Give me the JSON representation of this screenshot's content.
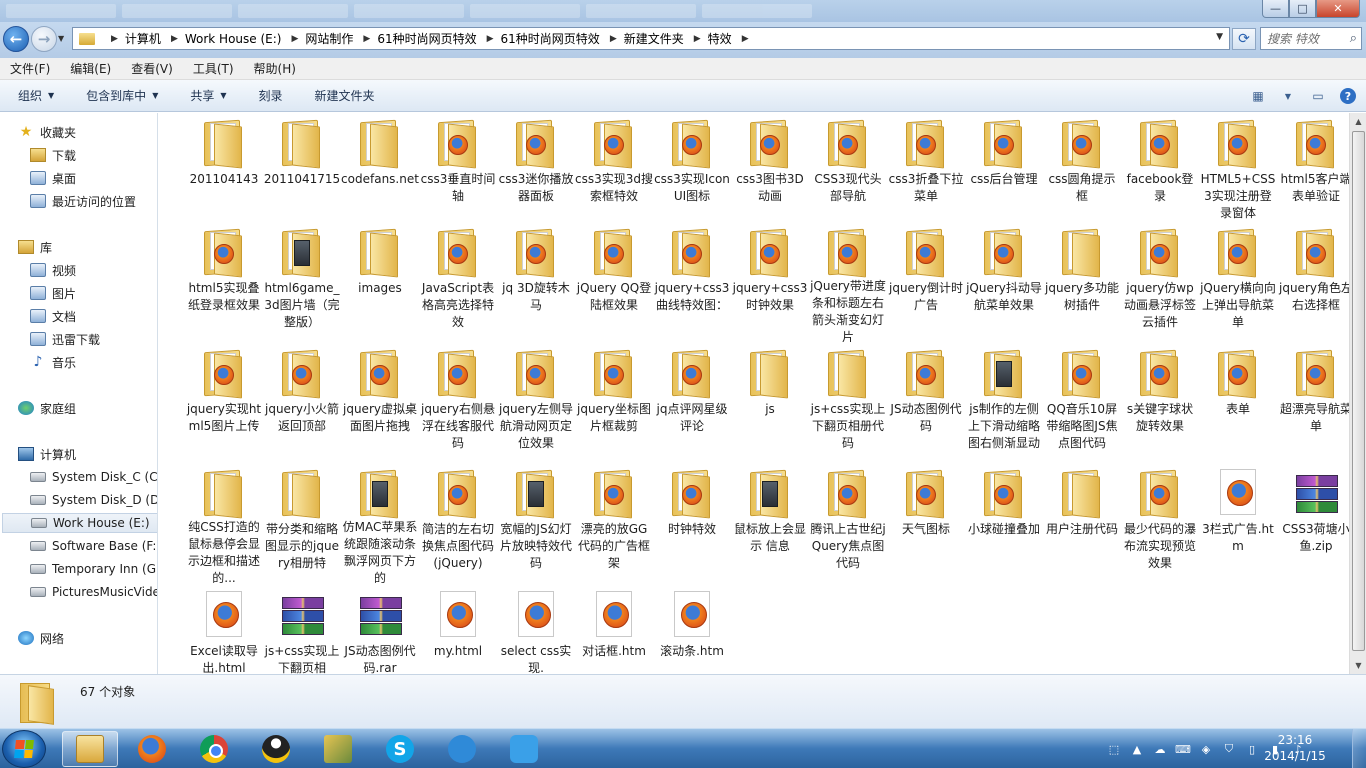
{
  "window": {
    "buttons": {
      "minimize": "—",
      "maximize": "□",
      "close": "✕"
    }
  },
  "address_bar": {
    "crumbs": [
      "计算机",
      "Work House (E:)",
      "网站制作",
      "61种时尚网页特效",
      "61种时尚网页特效",
      "新建文件夹",
      "特效"
    ],
    "search_placeholder": "搜索 特效"
  },
  "menu": [
    "文件(F)",
    "编辑(E)",
    "查看(V)",
    "工具(T)",
    "帮助(H)"
  ],
  "toolbar": {
    "organize": "组织",
    "include_in_library": "包含到库中",
    "share": "共享",
    "burn": "刻录",
    "new_folder": "新建文件夹"
  },
  "nav": {
    "favorites": "收藏夹",
    "downloads": "下载",
    "desktop": "桌面",
    "recent": "最近访问的位置",
    "libraries": "库",
    "videos": "视频",
    "pictures": "图片",
    "documents": "文档",
    "xunlei": "迅雷下载",
    "music": "音乐",
    "homegroup": "家庭组",
    "computer": "计算机",
    "drive_c": "System Disk_C  (C:",
    "drive_d": "System Disk_D (D:)",
    "drive_e": "Work House (E:)",
    "drive_f": "Software Base (F:)",
    "drive_g": "Temporary Inn (G:",
    "drive_h": "PicturesMusicVide",
    "network": "网络"
  },
  "items": [
    {
      "name": "201104143",
      "kind": "folder"
    },
    {
      "name": "2011041715",
      "kind": "folder"
    },
    {
      "name": "codefans.net",
      "kind": "folder"
    },
    {
      "name": "css3垂直时间轴",
      "kind": "folder-ff"
    },
    {
      "name": "css3迷你播放器面板",
      "kind": "folder-ff"
    },
    {
      "name": "css3实现3d搜索框特效",
      "kind": "folder-ff"
    },
    {
      "name": "css3实现Icon UI图标",
      "kind": "folder-ff"
    },
    {
      "name": "css3图书3D动画",
      "kind": "folder-ff"
    },
    {
      "name": "CSS3现代头部导航",
      "kind": "folder-ff"
    },
    {
      "name": "css3折叠下拉菜单",
      "kind": "folder-ff"
    },
    {
      "name": "css后台管理",
      "kind": "folder-ff"
    },
    {
      "name": "css圆角提示框",
      "kind": "folder-ff"
    },
    {
      "name": "facebook登录",
      "kind": "folder-ff"
    },
    {
      "name": "HTML5+CSS3实现注册登录窗体",
      "kind": "folder-ff"
    },
    {
      "name": "html5客户端表单验证",
      "kind": "folder-ff"
    },
    {
      "name": "html5实现叠纸登录框效果",
      "kind": "folder-ff"
    },
    {
      "name": "html6game_3d图片墙（完整版）",
      "kind": "folder-dark"
    },
    {
      "name": "images",
      "kind": "folder"
    },
    {
      "name": "JavaScript表格高亮选择特效",
      "kind": "folder-ff"
    },
    {
      "name": "jq 3D旋转木马",
      "kind": "folder-ff"
    },
    {
      "name": "jQuery QQ登陆框效果",
      "kind": "folder-ff"
    },
    {
      "name": "jquery+css3曲线特效图：",
      "kind": "folder-ff"
    },
    {
      "name": "jquery+css3时钟效果",
      "kind": "folder-ff"
    },
    {
      "name": "jQuery带进度条和标题左右箭头渐变幻灯片",
      "kind": "folder-ff"
    },
    {
      "name": "jquery倒计时广告",
      "kind": "folder-ff"
    },
    {
      "name": "jQuery抖动导航菜单效果",
      "kind": "folder-ff"
    },
    {
      "name": "jquery多功能树插件",
      "kind": "folder"
    },
    {
      "name": "jquery仿wp动画悬浮标签云插件",
      "kind": "folder-ff"
    },
    {
      "name": "jQuery横向向上弹出导航菜单",
      "kind": "folder-ff"
    },
    {
      "name": "jquery角色左右选择框",
      "kind": "folder-ff"
    },
    {
      "name": "jquery实现html5图片上传",
      "kind": "folder-ff"
    },
    {
      "name": "jquery小火箭返回顶部",
      "kind": "folder-ff"
    },
    {
      "name": "jquery虚拟桌面图片拖拽",
      "kind": "folder-ff"
    },
    {
      "name": "jquery右侧悬浮在线客服代码",
      "kind": "folder-ff"
    },
    {
      "name": "jquery左侧导航滑动网页定位效果",
      "kind": "folder-ff"
    },
    {
      "name": "jquery坐标图片框裁剪",
      "kind": "folder-ff"
    },
    {
      "name": "jq点评网星级评论",
      "kind": "folder-ff"
    },
    {
      "name": "js",
      "kind": "folder"
    },
    {
      "name": "js+css实现上下翻页相册代码",
      "kind": "folder"
    },
    {
      "name": "JS动态图例代码",
      "kind": "folder-ff"
    },
    {
      "name": "js制作的左侧上下滑动缩略图右侧渐显动",
      "kind": "folder-dark"
    },
    {
      "name": "QQ音乐10屏带缩略图JS焦点图代码",
      "kind": "folder-ff"
    },
    {
      "name": "s关键字球状旋转效果",
      "kind": "folder-ff"
    },
    {
      "name": "表单",
      "kind": "folder-ff"
    },
    {
      "name": "超漂亮导航菜单",
      "kind": "folder-ff"
    },
    {
      "name": "纯CSS打造的鼠标悬停会显示边框和描述的...",
      "kind": "folder"
    },
    {
      "name": "带分类和缩略图显示的jquery相册特",
      "kind": "folder"
    },
    {
      "name": "仿MAC苹果系统跟随滚动条飘浮网页下方的",
      "kind": "folder-dark"
    },
    {
      "name": "简洁的左右切换焦点图代码(jQuery)",
      "kind": "folder-ff"
    },
    {
      "name": "宽幅的JS幻灯片放映特效代码",
      "kind": "folder-dark"
    },
    {
      "name": "漂亮的放GG代码的广告框架",
      "kind": "folder-ff"
    },
    {
      "name": "时钟特效",
      "kind": "folder-ff"
    },
    {
      "name": "鼠标放上会显示 信息",
      "kind": "folder-dark"
    },
    {
      "name": "腾讯上古世纪jQuery焦点图代码",
      "kind": "folder-ff"
    },
    {
      "name": "天气图标",
      "kind": "folder-ff"
    },
    {
      "name": "小球碰撞叠加",
      "kind": "folder-ff"
    },
    {
      "name": "用户注册代码",
      "kind": "folder"
    },
    {
      "name": "最少代码的瀑布流实现预览效果",
      "kind": "folder-ff"
    },
    {
      "name": "3栏式广告.htm",
      "kind": "firefox-file"
    },
    {
      "name": "CSS3荷塘小鱼.zip",
      "kind": "rar"
    },
    {
      "name": "Excel读取导出.html",
      "kind": "firefox-file"
    },
    {
      "name": "js+css实现上下翻页相",
      "kind": "rar"
    },
    {
      "name": "JS动态图例代码.rar",
      "kind": "rar"
    },
    {
      "name": "my.html",
      "kind": "firefox-file"
    },
    {
      "name": "select css实现.",
      "kind": "firefox-file"
    },
    {
      "name": "对话框.htm",
      "kind": "firefox-file"
    },
    {
      "name": "滚动条.htm",
      "kind": "firefox-file"
    }
  ],
  "status": {
    "count": "67 个对象"
  },
  "taskbar": {
    "time": "23:16",
    "date": "2014/1/15"
  }
}
